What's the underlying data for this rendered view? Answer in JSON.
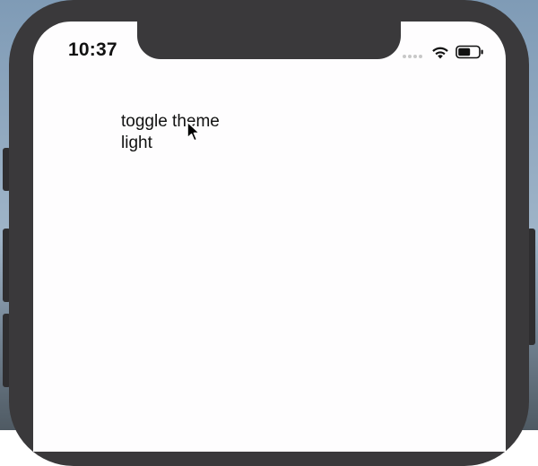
{
  "status_bar": {
    "time": "10:37",
    "signal_icon": "signal-dots-icon",
    "wifi_icon": "wifi-icon",
    "battery_icon": "battery-icon",
    "battery_level": 0.6
  },
  "app": {
    "toggle_label": "toggle theme",
    "theme_value": "light"
  },
  "colors": {
    "screen_background": "#fefdfe",
    "device_frame": "#3a393b",
    "text": "#111111"
  }
}
